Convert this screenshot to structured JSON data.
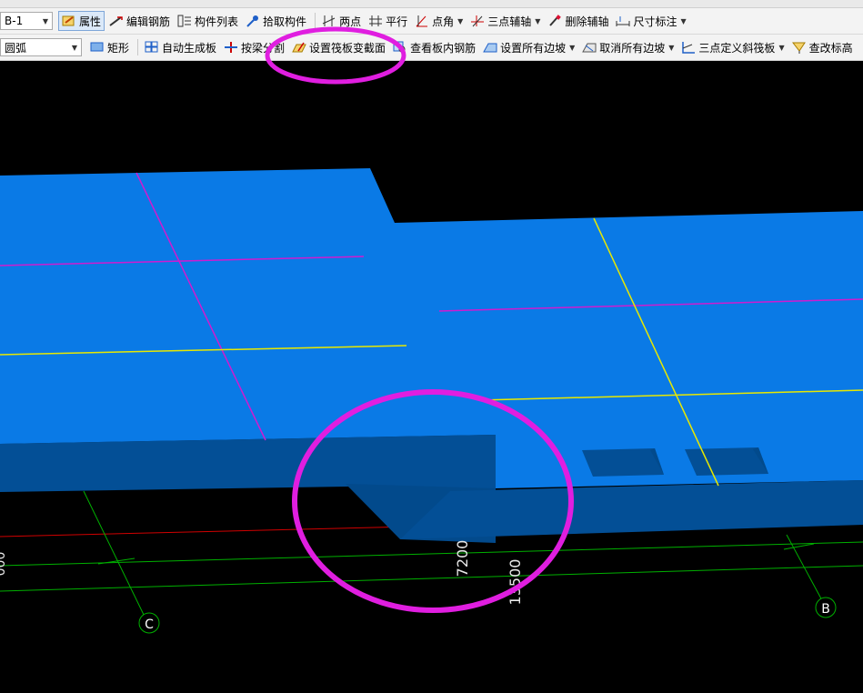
{
  "toolbar1": {
    "layer_value": "B-1",
    "properties": "属性",
    "edit_rebar": "编辑钢筋",
    "component_list": "构件列表",
    "pick_component": "拾取构件",
    "two_points": "两点",
    "parallel": "平行",
    "point_angle": "点角",
    "three_point_axis": "三点辅轴",
    "delete_axis": "删除辅轴",
    "dimension": "尺寸标注"
  },
  "toolbar2": {
    "draw_mode_value": "圆弧",
    "rectangle": "矩形",
    "auto_generate": "自动生成板",
    "split_by_beam": "按梁分割",
    "set_raft_section": "设置筏板变截面",
    "view_slab_rebar": "查看板内钢筋",
    "set_all_slopes": "设置所有边坡",
    "cancel_all_slopes": "取消所有边坡",
    "three_point_slope": "三点定义斜筏板",
    "check_elevation": "查改标高"
  },
  "viewport": {
    "dim_7200": "7200",
    "dim_13500": "13500",
    "dim_left_partial": "000",
    "axis_c": "C",
    "axis_b": "B"
  },
  "colors": {
    "slab_top": "#0a7ae6",
    "slab_side": "#034f96",
    "slab_side_dark": "#024a8c",
    "magenta_line": "#d01bd0",
    "yellow_line": "#e8e800",
    "annotation_circle": "#e01ee0",
    "grid_green": "#00c000",
    "grid_red": "#d00000"
  }
}
